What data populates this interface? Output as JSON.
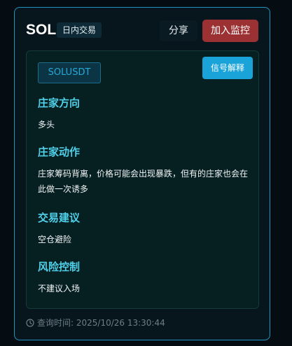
{
  "header": {
    "symbol": "SOL",
    "type_badge": "日内交易",
    "share_label": "分享",
    "monitor_label": "加入监控"
  },
  "panel": {
    "pair": "SOLUSDT",
    "explain_label": "信号解释",
    "sections": [
      {
        "title": "庄家方向",
        "text": "多头"
      },
      {
        "title": "庄家动作",
        "text": "庄家筹码背离，价格可能会出现暴跌，但有的庄家也会在此做一次诱多"
      },
      {
        "title": "交易建议",
        "text": "空仓避险"
      },
      {
        "title": "风险控制",
        "text": "不建议入场"
      }
    ]
  },
  "footer": {
    "query_time": "查询时间: 2025/10/26 13:30:44",
    "icon": "clock-icon"
  },
  "colors": {
    "accent": "#1aa3d8",
    "section_title": "#4fd0e8",
    "monitor_button": "#9c3133",
    "card_border": "#1f93c1"
  }
}
